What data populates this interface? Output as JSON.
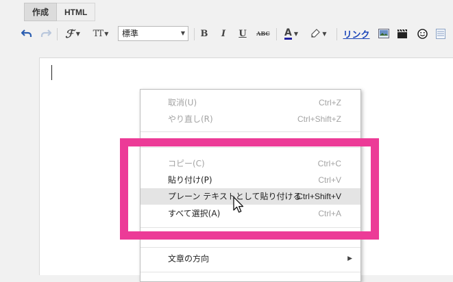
{
  "tabs": [
    {
      "label": "作成",
      "active": true
    },
    {
      "label": "HTML",
      "active": false
    }
  ],
  "toolbar": {
    "font_icon": "ℱ",
    "size_icon": "TT",
    "style_value": "標準",
    "bold": "B",
    "italic": "I",
    "underline": "U",
    "strike": "ABC",
    "text_color": "A",
    "link": "リンク"
  },
  "menu": {
    "items": [
      {
        "label": "取消(U)",
        "shortcut": "Ctrl+Z",
        "state": "disabled"
      },
      {
        "label": "やり直し(R)",
        "shortcut": "Ctrl+Shift+Z",
        "state": "disabled"
      },
      {
        "label": "コピー(C)",
        "shortcut": "Ctrl+C",
        "state": "disabled"
      },
      {
        "label": "貼り付け(P)",
        "shortcut": "Ctrl+V",
        "state": "enabled"
      },
      {
        "label": "プレーン テキストとして貼り付ける",
        "shortcut": "Ctrl+Shift+V",
        "state": "hover"
      },
      {
        "label": "すべて選択(A)",
        "shortcut": "Ctrl+A",
        "state": "enabled"
      },
      {
        "label": "文章の方向",
        "shortcut": "",
        "state": "submenu"
      }
    ]
  },
  "colors": {
    "highlight": "#ec3b97",
    "link": "#1a44b8",
    "menu_hover": "#e4e4e4",
    "disabled_text": "#a3a3a3"
  }
}
